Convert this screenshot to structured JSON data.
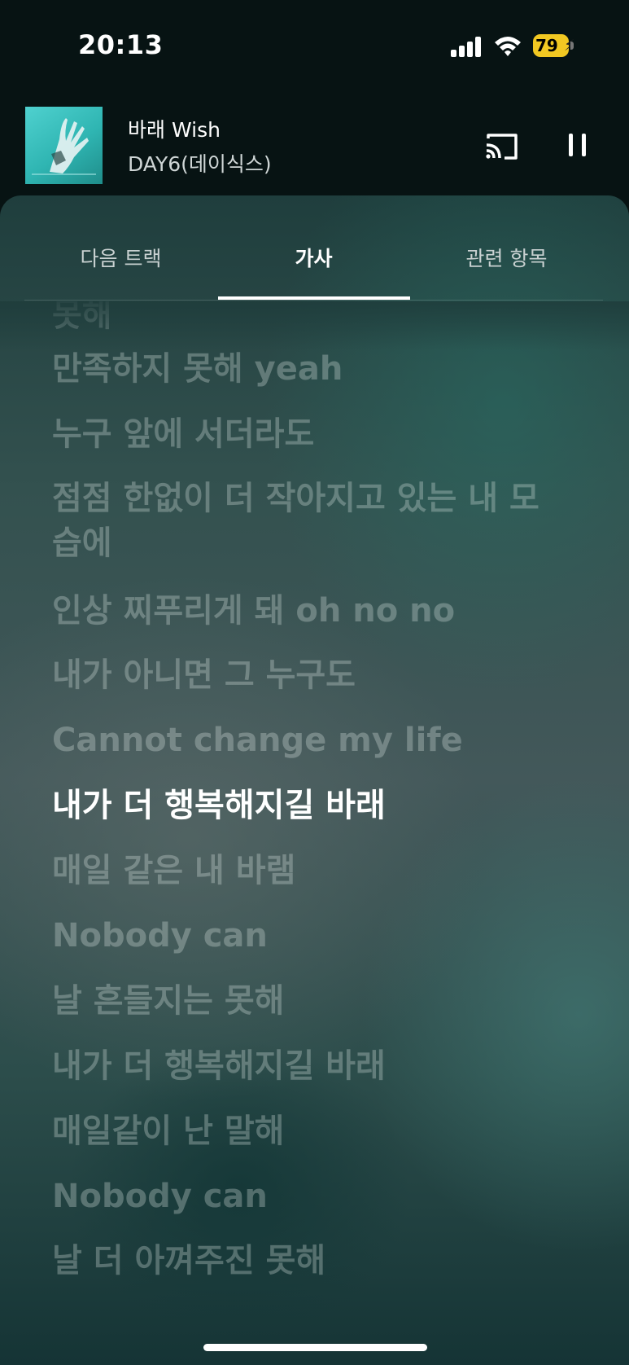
{
  "status_bar": {
    "time": "20:13",
    "battery_percent": "79",
    "signal_icon": "cellular-signal-icon",
    "wifi_icon": "wifi-icon",
    "battery_color": "#f2c822"
  },
  "now_playing": {
    "title": "바래 Wish",
    "artist": "DAY6(데이식스)",
    "cast_icon": "cast-icon",
    "pause_icon": "pause-icon",
    "album_color": "#3cc4c1"
  },
  "tabs": [
    {
      "label": "다음 트랙",
      "active": false
    },
    {
      "label": "가사",
      "active": true
    },
    {
      "label": "관련 항목",
      "active": false
    }
  ],
  "lyrics": [
    "못해",
    "만족하지 못해 yeah",
    "누구 앞에 서더라도",
    "점점 한없이 더 작아지고 있는 내 모",
    "습에",
    "인상 찌푸리게 돼 oh no no",
    "내가 아니면 그 누구도",
    "Cannot change my life",
    "내가 더 행복해지길 바래",
    "매일 같은 내 바램",
    "Nobody can",
    "날 흔들지는 못해",
    "내가 더 행복해지길 바래",
    "매일같이 난 말해",
    "Nobody can",
    "날 더 아껴주진 못해"
  ],
  "current_lyric_index": 8
}
